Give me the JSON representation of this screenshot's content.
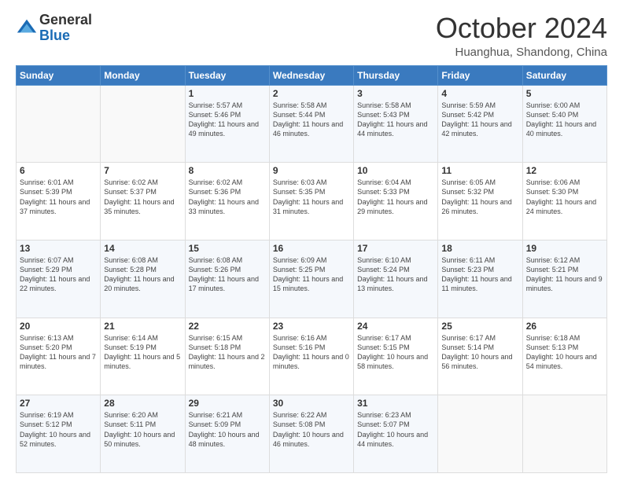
{
  "header": {
    "logo_general": "General",
    "logo_blue": "Blue",
    "month_title": "October 2024",
    "location": "Huanghua, Shandong, China"
  },
  "days_of_week": [
    "Sunday",
    "Monday",
    "Tuesday",
    "Wednesday",
    "Thursday",
    "Friday",
    "Saturday"
  ],
  "weeks": [
    [
      {
        "day": "",
        "sunrise": "",
        "sunset": "",
        "daylight": ""
      },
      {
        "day": "",
        "sunrise": "",
        "sunset": "",
        "daylight": ""
      },
      {
        "day": "1",
        "sunrise": "Sunrise: 5:57 AM",
        "sunset": "Sunset: 5:46 PM",
        "daylight": "Daylight: 11 hours and 49 minutes."
      },
      {
        "day": "2",
        "sunrise": "Sunrise: 5:58 AM",
        "sunset": "Sunset: 5:44 PM",
        "daylight": "Daylight: 11 hours and 46 minutes."
      },
      {
        "day": "3",
        "sunrise": "Sunrise: 5:58 AM",
        "sunset": "Sunset: 5:43 PM",
        "daylight": "Daylight: 11 hours and 44 minutes."
      },
      {
        "day": "4",
        "sunrise": "Sunrise: 5:59 AM",
        "sunset": "Sunset: 5:42 PM",
        "daylight": "Daylight: 11 hours and 42 minutes."
      },
      {
        "day": "5",
        "sunrise": "Sunrise: 6:00 AM",
        "sunset": "Sunset: 5:40 PM",
        "daylight": "Daylight: 11 hours and 40 minutes."
      }
    ],
    [
      {
        "day": "6",
        "sunrise": "Sunrise: 6:01 AM",
        "sunset": "Sunset: 5:39 PM",
        "daylight": "Daylight: 11 hours and 37 minutes."
      },
      {
        "day": "7",
        "sunrise": "Sunrise: 6:02 AM",
        "sunset": "Sunset: 5:37 PM",
        "daylight": "Daylight: 11 hours and 35 minutes."
      },
      {
        "day": "8",
        "sunrise": "Sunrise: 6:02 AM",
        "sunset": "Sunset: 5:36 PM",
        "daylight": "Daylight: 11 hours and 33 minutes."
      },
      {
        "day": "9",
        "sunrise": "Sunrise: 6:03 AM",
        "sunset": "Sunset: 5:35 PM",
        "daylight": "Daylight: 11 hours and 31 minutes."
      },
      {
        "day": "10",
        "sunrise": "Sunrise: 6:04 AM",
        "sunset": "Sunset: 5:33 PM",
        "daylight": "Daylight: 11 hours and 29 minutes."
      },
      {
        "day": "11",
        "sunrise": "Sunrise: 6:05 AM",
        "sunset": "Sunset: 5:32 PM",
        "daylight": "Daylight: 11 hours and 26 minutes."
      },
      {
        "day": "12",
        "sunrise": "Sunrise: 6:06 AM",
        "sunset": "Sunset: 5:30 PM",
        "daylight": "Daylight: 11 hours and 24 minutes."
      }
    ],
    [
      {
        "day": "13",
        "sunrise": "Sunrise: 6:07 AM",
        "sunset": "Sunset: 5:29 PM",
        "daylight": "Daylight: 11 hours and 22 minutes."
      },
      {
        "day": "14",
        "sunrise": "Sunrise: 6:08 AM",
        "sunset": "Sunset: 5:28 PM",
        "daylight": "Daylight: 11 hours and 20 minutes."
      },
      {
        "day": "15",
        "sunrise": "Sunrise: 6:08 AM",
        "sunset": "Sunset: 5:26 PM",
        "daylight": "Daylight: 11 hours and 17 minutes."
      },
      {
        "day": "16",
        "sunrise": "Sunrise: 6:09 AM",
        "sunset": "Sunset: 5:25 PM",
        "daylight": "Daylight: 11 hours and 15 minutes."
      },
      {
        "day": "17",
        "sunrise": "Sunrise: 6:10 AM",
        "sunset": "Sunset: 5:24 PM",
        "daylight": "Daylight: 11 hours and 13 minutes."
      },
      {
        "day": "18",
        "sunrise": "Sunrise: 6:11 AM",
        "sunset": "Sunset: 5:23 PM",
        "daylight": "Daylight: 11 hours and 11 minutes."
      },
      {
        "day": "19",
        "sunrise": "Sunrise: 6:12 AM",
        "sunset": "Sunset: 5:21 PM",
        "daylight": "Daylight: 11 hours and 9 minutes."
      }
    ],
    [
      {
        "day": "20",
        "sunrise": "Sunrise: 6:13 AM",
        "sunset": "Sunset: 5:20 PM",
        "daylight": "Daylight: 11 hours and 7 minutes."
      },
      {
        "day": "21",
        "sunrise": "Sunrise: 6:14 AM",
        "sunset": "Sunset: 5:19 PM",
        "daylight": "Daylight: 11 hours and 5 minutes."
      },
      {
        "day": "22",
        "sunrise": "Sunrise: 6:15 AM",
        "sunset": "Sunset: 5:18 PM",
        "daylight": "Daylight: 11 hours and 2 minutes."
      },
      {
        "day": "23",
        "sunrise": "Sunrise: 6:16 AM",
        "sunset": "Sunset: 5:16 PM",
        "daylight": "Daylight: 11 hours and 0 minutes."
      },
      {
        "day": "24",
        "sunrise": "Sunrise: 6:17 AM",
        "sunset": "Sunset: 5:15 PM",
        "daylight": "Daylight: 10 hours and 58 minutes."
      },
      {
        "day": "25",
        "sunrise": "Sunrise: 6:17 AM",
        "sunset": "Sunset: 5:14 PM",
        "daylight": "Daylight: 10 hours and 56 minutes."
      },
      {
        "day": "26",
        "sunrise": "Sunrise: 6:18 AM",
        "sunset": "Sunset: 5:13 PM",
        "daylight": "Daylight: 10 hours and 54 minutes."
      }
    ],
    [
      {
        "day": "27",
        "sunrise": "Sunrise: 6:19 AM",
        "sunset": "Sunset: 5:12 PM",
        "daylight": "Daylight: 10 hours and 52 minutes."
      },
      {
        "day": "28",
        "sunrise": "Sunrise: 6:20 AM",
        "sunset": "Sunset: 5:11 PM",
        "daylight": "Daylight: 10 hours and 50 minutes."
      },
      {
        "day": "29",
        "sunrise": "Sunrise: 6:21 AM",
        "sunset": "Sunset: 5:09 PM",
        "daylight": "Daylight: 10 hours and 48 minutes."
      },
      {
        "day": "30",
        "sunrise": "Sunrise: 6:22 AM",
        "sunset": "Sunset: 5:08 PM",
        "daylight": "Daylight: 10 hours and 46 minutes."
      },
      {
        "day": "31",
        "sunrise": "Sunrise: 6:23 AM",
        "sunset": "Sunset: 5:07 PM",
        "daylight": "Daylight: 10 hours and 44 minutes."
      },
      {
        "day": "",
        "sunrise": "",
        "sunset": "",
        "daylight": ""
      },
      {
        "day": "",
        "sunrise": "",
        "sunset": "",
        "daylight": ""
      }
    ]
  ]
}
